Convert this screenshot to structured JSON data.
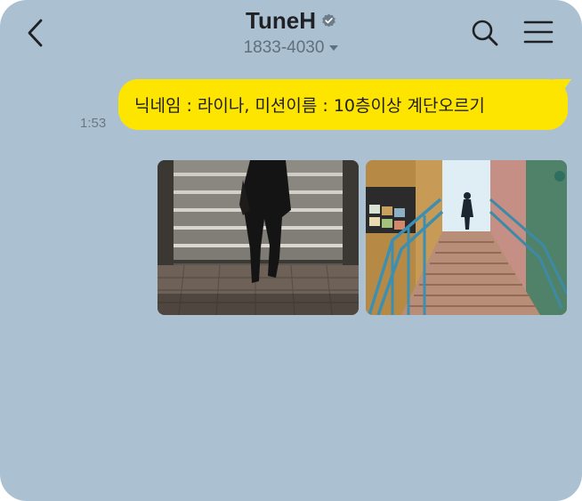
{
  "header": {
    "title": "TuneH",
    "subtitle": "1833-4030",
    "back_icon": "chevron-left-icon",
    "verified_icon": "verified-badge-icon",
    "search_icon": "search-icon",
    "menu_icon": "hamburger-menu-icon"
  },
  "chat": {
    "message": {
      "time": "1:53",
      "text": "닉네임 : 라이나, 미션이름 :  10층이상 계단오르기"
    },
    "images": [
      {
        "description": "person-walking-up-granite-stairs"
      },
      {
        "description": "person-at-top-of-outdoor-staircase"
      }
    ]
  },
  "colors": {
    "background": "#abc1d2",
    "bubble": "#fee500",
    "text": "#1f2124"
  }
}
